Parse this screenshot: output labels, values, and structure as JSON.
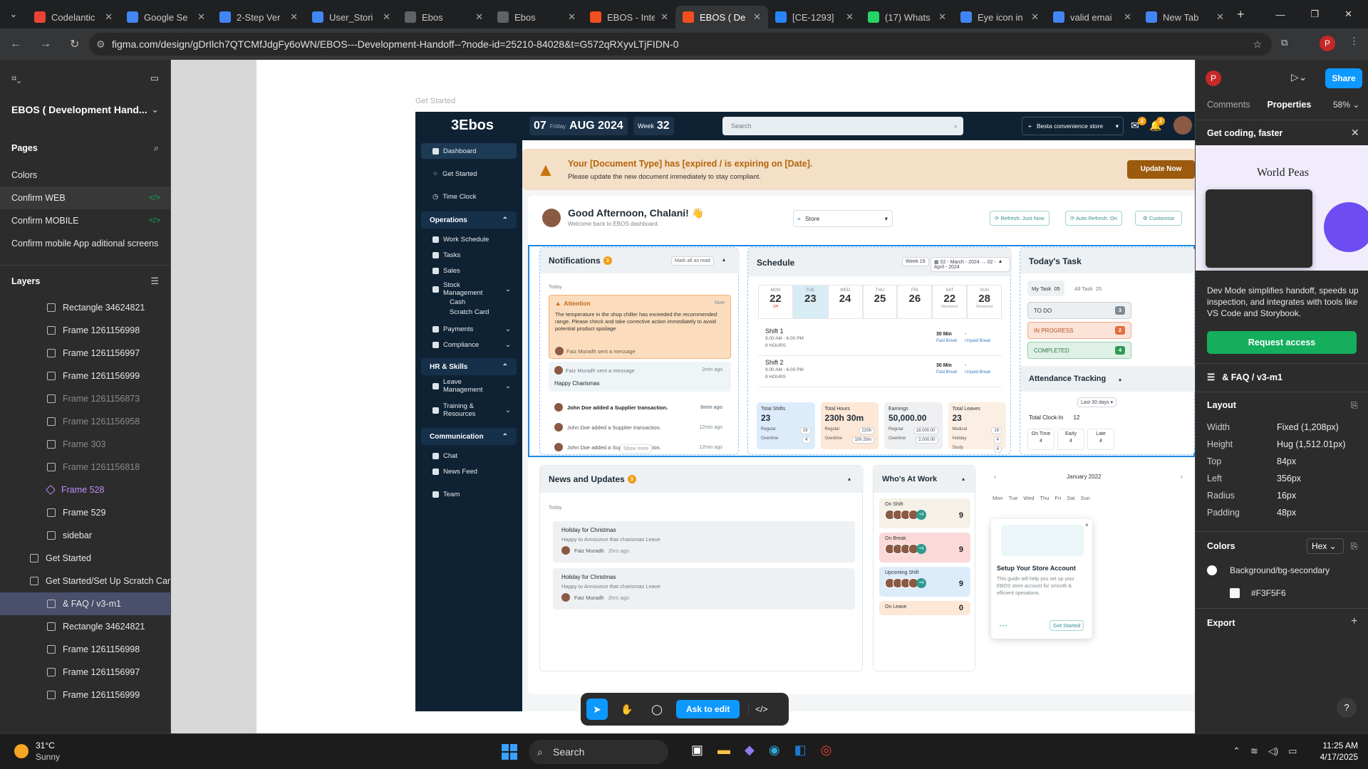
{
  "browser": {
    "tabs": [
      {
        "label": "Codelantic",
        "color": "#ea4335",
        "active": false
      },
      {
        "label": "Google Se",
        "color": "#4285f4",
        "active": false
      },
      {
        "label": "2-Step Ver",
        "color": "#4285f4",
        "active": false
      },
      {
        "label": "User_Stori",
        "color": "#4285f4",
        "active": false
      },
      {
        "label": "Ebos",
        "color": "#5f6368",
        "active": false
      },
      {
        "label": "Ebos",
        "color": "#5f6368",
        "active": false
      },
      {
        "label": "EBOS - Inte",
        "color": "#f24e1e",
        "active": false
      },
      {
        "label": "EBOS ( De",
        "color": "#f24e1e",
        "active": true
      },
      {
        "label": "[CE-1293]",
        "color": "#2684ff",
        "active": false
      },
      {
        "label": "(17) Whats",
        "color": "#25d366",
        "active": false
      },
      {
        "label": "Eye icon in",
        "color": "#4285f4",
        "active": false
      },
      {
        "label": "valid emai",
        "color": "#4285f4",
        "active": false
      },
      {
        "label": "New Tab",
        "color": "#4285f4",
        "active": false
      }
    ],
    "url": "figma.com/design/gDrIlch7QTCMfJdgFy6oWN/EBOS---Development-Handoff--?node-id=25210-84028&t=G572qRXyvLTjFIDN-0",
    "profile": "P"
  },
  "figma_left": {
    "file_title": "EBOS ( Development Hand...",
    "pages_label": "Pages",
    "pages": [
      "Colors",
      "Confirm WEB",
      "Confirm  MOBILE",
      "Confirm mobile App aditional screens"
    ],
    "layers_label": "Layers",
    "layers": [
      {
        "label": "Rectangle 34624821",
        "indent": 2,
        "dim": false,
        "selected": false,
        "purple": false
      },
      {
        "label": "Frame 1261156998",
        "indent": 2,
        "dim": false,
        "selected": false,
        "purple": false
      },
      {
        "label": "Frame 1261156997",
        "indent": 2,
        "dim": false,
        "selected": false,
        "purple": false
      },
      {
        "label": "Frame 1261156999",
        "indent": 2,
        "dim": false,
        "selected": false,
        "purple": false
      },
      {
        "label": "Frame 1261156873",
        "indent": 2,
        "dim": true,
        "selected": false,
        "purple": false
      },
      {
        "label": "Frame 1261156958",
        "indent": 2,
        "dim": true,
        "selected": false,
        "purple": false
      },
      {
        "label": "Frame 303",
        "indent": 2,
        "dim": true,
        "selected": false,
        "purple": false
      },
      {
        "label": "Frame 1261156818",
        "indent": 2,
        "dim": true,
        "selected": false,
        "purple": false
      },
      {
        "label": "Frame 528",
        "indent": 2,
        "dim": false,
        "selected": false,
        "purple": true
      },
      {
        "label": "Frame 529",
        "indent": 2,
        "dim": false,
        "selected": false,
        "purple": false
      },
      {
        "label": "sidebar",
        "indent": 2,
        "dim": false,
        "selected": false,
        "purple": false
      },
      {
        "label": "Get Started",
        "indent": 1,
        "dim": false,
        "selected": false,
        "purple": false
      },
      {
        "label": "Get Started/Set Up Scratch Cards",
        "indent": 1,
        "dim": false,
        "selected": false,
        "purple": false
      },
      {
        "label": "& FAQ / v3-m1",
        "indent": 2,
        "dim": false,
        "selected": true,
        "purple": false
      },
      {
        "label": "Rectangle 34624821",
        "indent": 2,
        "dim": false,
        "selected": false,
        "purple": false
      },
      {
        "label": "Frame 1261156998",
        "indent": 2,
        "dim": false,
        "selected": false,
        "purple": false
      },
      {
        "label": "Frame 1261156997",
        "indent": 2,
        "dim": false,
        "selected": false,
        "purple": false
      },
      {
        "label": "Frame 1261156999",
        "indent": 2,
        "dim": false,
        "selected": false,
        "purple": false
      }
    ]
  },
  "figma_right": {
    "tabs": [
      "Comments",
      "Properties"
    ],
    "zoom": "58%",
    "share": "Share",
    "promo_title": "Get coding, faster",
    "promo_image_text": "World Peas",
    "promo_desc": "Dev Mode simplifies handoff, speeds up inspection, and integrates with tools like VS Code and Storybook.",
    "request_access": "Request access",
    "selection": "& FAQ / v3-m1",
    "layout_label": "Layout",
    "layout": [
      {
        "k": "Width",
        "v": "Fixed (1,208px)"
      },
      {
        "k": "Height",
        "v": "Hug (1,512.01px)"
      },
      {
        "k": "Top",
        "v": "84px"
      },
      {
        "k": "Left",
        "v": "356px"
      },
      {
        "k": "Radius",
        "v": "16px"
      },
      {
        "k": "Padding",
        "v": "48px"
      }
    ],
    "colors_label": "Colors",
    "color_format": "Hex",
    "color_token": "Background/bg-secondary",
    "color_hex": "#F3F5F6",
    "export_label": "Export"
  },
  "canvas": {
    "frame_label": "Get Started",
    "toolbar_ask": "Ask to edit"
  },
  "app": {
    "logo": "Ebos",
    "date_day": "07",
    "date_weekday": "Friday",
    "date_month": "AUG 2024",
    "week_label": "Week",
    "week_num": "32",
    "search_placeholder": "Search",
    "store_select": "Besta convenience store",
    "msg_count": "2",
    "notif_count": "2",
    "alert_title": "Your [Document Type] has [expired / is expiring on [Date].",
    "alert_body": "Please update the new document immediately to stay compliant.",
    "alert_button": "Update Now",
    "greeting": "Good Afternoon, Chalani! 👋",
    "greeting_sub": "Welcome back to EBOS dashboard.",
    "store_filter": "Store",
    "refresh": "Refresh: Just Now",
    "autorefresh": "Auto Refresh: On",
    "customise": "Customise",
    "sidebar": {
      "top": [
        "Dashboard",
        "Get Started",
        "Time Clock"
      ],
      "operations": "Operations",
      "ops_items": [
        "Work Schedule",
        "Tasks",
        "Sales",
        "Stock Management"
      ],
      "stock_sub": [
        "Cash",
        "Scratch Card"
      ],
      "ops_more": [
        "Payments",
        "Compliance"
      ],
      "hr": "HR & Skills",
      "hr_items": [
        "Leave Management",
        "Training & Resources"
      ],
      "comm": "Communication",
      "comm_items": [
        "Chat",
        "News Feed"
      ],
      "team": "Team"
    },
    "notifications": {
      "title": "Notifications",
      "count": "3",
      "mark": "Mark all as read",
      "today": "Today",
      "attention_title": "Attention",
      "attention_time": "Now",
      "attention_body": "The temperature in the shop chiller has exceeded the recommended range. Please check and take corrective action immediately to avoid potential product spoilage",
      "attention_from": "Faiz Muradh sent a message",
      "msg_from": "Faiz Muradh sent a message",
      "msg_time": "2min ago",
      "msg_body": "Happy Charismas",
      "items": [
        {
          "text": "John Doe added a Supplier transaction.",
          "time": "8min ago"
        },
        {
          "text": "John Doe added a Supplier transaction.",
          "time": "12min ago"
        },
        {
          "text": "John Doe added a Supplier transaction.",
          "time": "12min ago"
        }
      ],
      "show_more": "Show more"
    },
    "schedule": {
      "title": "Schedule",
      "week": "Week 19",
      "range_from": "02 - March - 2024",
      "range_to": "02 - April - 2024",
      "days": [
        {
          "d": "MON",
          "n": "22",
          "s": "Off"
        },
        {
          "d": "TUE",
          "n": "23",
          "s": ""
        },
        {
          "d": "WED",
          "n": "24",
          "s": ""
        },
        {
          "d": "THU",
          "n": "25",
          "s": ""
        },
        {
          "d": "FRI",
          "n": "26",
          "s": ""
        },
        {
          "d": "SAT",
          "n": "22",
          "s": "Weekend"
        },
        {
          "d": "SUN",
          "n": "28",
          "s": "Weekend"
        }
      ],
      "shifts": [
        {
          "name": "Shift 1",
          "time": "9.00 AM - 6.00 PM",
          "hours": "8 HOURS",
          "b1": "30 Min",
          "b1s": "Paid Break",
          "b2": "-",
          "b2s": "Unpaid Break"
        },
        {
          "name": "Shift 2",
          "time": "9.00 AM - 6.00 PM",
          "hours": "8 HOURS",
          "b1": "30 Min",
          "b1s": "Paid Break",
          "b2": "-",
          "b2s": "Unpaid Break"
        }
      ],
      "stats": [
        {
          "title": "Total Shifts",
          "value": "23",
          "r1": "Regular",
          "v1": "19",
          "r2": "Overtime",
          "v2": "4",
          "bg": "#dcecfb"
        },
        {
          "title": "Total Hours",
          "value": "230h 30m",
          "r1": "Regular",
          "v1": "220h",
          "r2": "Overtime",
          "v2": "10h 20m",
          "bg": "#fde7d6"
        },
        {
          "title": "Earnings",
          "value": "50,000.00",
          "r1": "Regular",
          "v1": "18,000.00",
          "r2": "Overtime",
          "v2": "2,000.00",
          "bg": "#eef0f2"
        },
        {
          "title": "Total Leaves",
          "value": "23",
          "r1": "Medical",
          "v1": "19",
          "r2": "Holiday",
          "v2": "4",
          "r3": "Study",
          "v3": "4",
          "bg": "#fbefe4"
        }
      ]
    },
    "today_task": {
      "title": "Today's Task",
      "my_task": "My Task",
      "my_count": "05",
      "all_task": "All Task",
      "all_count": "25",
      "todo": "TO DO",
      "todo_n": "3",
      "inprog": "IN PROGRESS",
      "inprog_n": "2",
      "done": "COMPLETED",
      "done_n": "4"
    },
    "attendance": {
      "title": "Attendance Tracking",
      "period": "Last 30 days",
      "clock_label": "Total Clock-In",
      "clock_n": "12",
      "cols": [
        {
          "k": "On Time",
          "v": "4"
        },
        {
          "k": "Early",
          "v": "4"
        },
        {
          "k": "Late",
          "v": "4"
        }
      ]
    },
    "news": {
      "title": "News and Updates",
      "count": "3",
      "today": "Today",
      "items": [
        {
          "title": "Holiday for Christmas",
          "body": "Happy to Announce that charismas Leave",
          "author": "Faiz Muradh",
          "time": "2hrs ago"
        },
        {
          "title": "Holiday for Christmas",
          "body": "Happy to Announce that charismas Leave",
          "author": "Faiz Muradh",
          "time": "2hrs ago"
        }
      ]
    },
    "who": {
      "title": "Who's At Work",
      "groups": [
        {
          "label": "On Shift",
          "n": "9",
          "bg": "#f5f1e6",
          "more": "+4"
        },
        {
          "label": "On Break",
          "n": "9",
          "bg": "#fbd9d9",
          "more": "+4"
        },
        {
          "label": "Upcoming Shift",
          "n": "9",
          "bg": "#dcecfb",
          "more": "+4"
        },
        {
          "label": "On Leave",
          "n": "0",
          "bg": "#fde7d6",
          "more": ""
        }
      ]
    },
    "calendar": {
      "month": "January 2022",
      "days": [
        "Mon",
        "Tue",
        "Wed",
        "Thu",
        "Fri",
        "Sat",
        "Sun"
      ]
    },
    "setup": {
      "title": "Setup Your Store Account",
      "body": "This guide will help you set up your EBOS store account for smooth & efficient operations.",
      "button": "Get Started"
    }
  },
  "taskbar": {
    "temp": "31°C",
    "weather": "Sunny",
    "search": "Search",
    "time": "11:25 AM",
    "date": "4/17/2025"
  }
}
